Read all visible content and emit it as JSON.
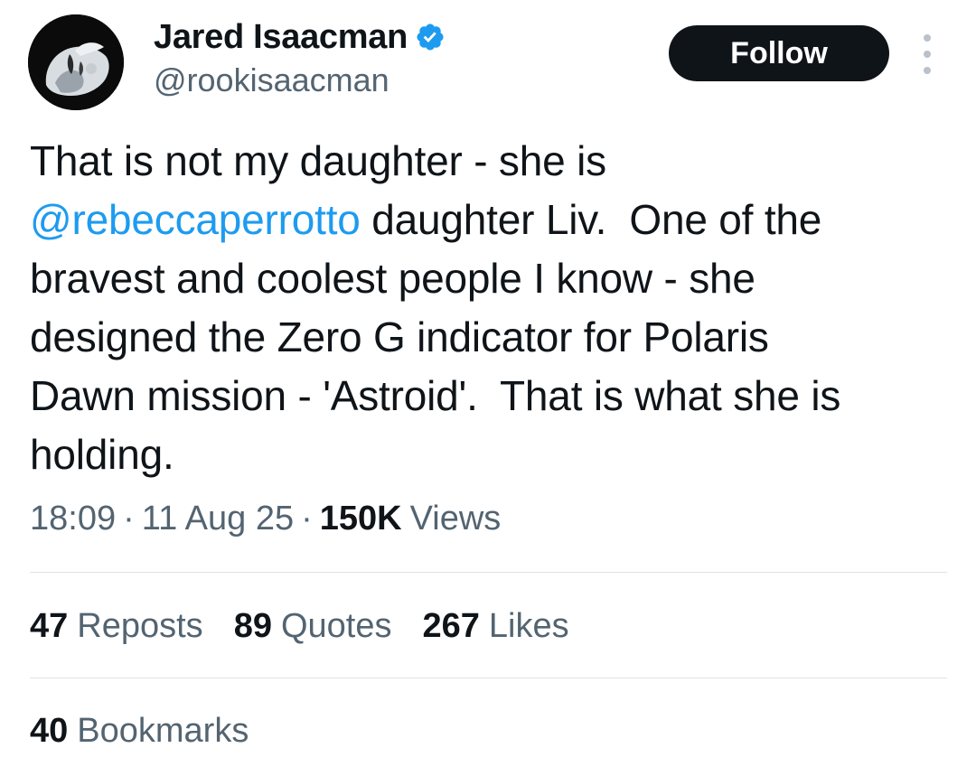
{
  "author": {
    "name": "Jared Isaacman",
    "handle": "@rookisaacman",
    "verified_icon": "verified-badge-icon",
    "avatar_icon": "avatar-image"
  },
  "actions": {
    "follow_label": "Follow",
    "more_icon": "more-options-icon"
  },
  "tweet": {
    "lines": [
      {
        "text": "That is not my daughter - she is"
      },
      {
        "mention": "@rebeccaperrotto",
        "text": " daughter Liv.  One of the"
      },
      {
        "text": "bravest and coolest people I know - she"
      },
      {
        "text": "designed the Zero G indicator for Polaris"
      },
      {
        "text": "Dawn mission - 'Astroid'.  That is what she is"
      },
      {
        "text": "holding."
      }
    ]
  },
  "meta": {
    "time": "18:09",
    "date": "11 Aug 25",
    "views_count": "150K",
    "views_label": "Views",
    "separator": "·"
  },
  "stats": {
    "reposts": {
      "count": "47",
      "label": "Reposts"
    },
    "quotes": {
      "count": "89",
      "label": "Quotes"
    },
    "likes": {
      "count": "267",
      "label": "Likes"
    },
    "bookmarks": {
      "count": "40",
      "label": "Bookmarks"
    }
  },
  "colors": {
    "link": "#1d9bf0",
    "secondary_text": "#536471",
    "primary_text": "#0f1419",
    "button_bg": "#0f1419"
  }
}
